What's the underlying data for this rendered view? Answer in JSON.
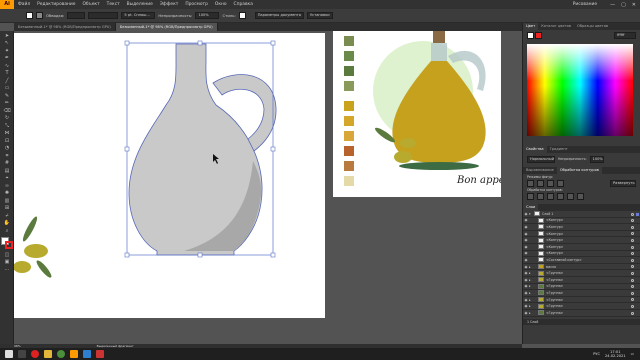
{
  "menubar": {
    "logo": "Ai",
    "items": [
      "Файл",
      "Редактирование",
      "Объект",
      "Текст",
      "Выделение",
      "Эффект",
      "Просмотр",
      "Окно",
      "Справка"
    ],
    "workspace": "Рисование"
  },
  "control": {
    "no_selection_swatch_1": "#ffffff",
    "stroke_label": "Обводка:",
    "brush": "5 pt. Сплош...",
    "opacity_label": "Непрозрачность:",
    "opacity_value": "100%",
    "style_label": "Стиль:",
    "doc_params_button": "Параметры документа",
    "settings_button": "Установки"
  },
  "tabs": [
    {
      "label": "Безымянный-1* @ 98% (RGB/Предпросмотр GPU)",
      "active": false
    },
    {
      "label": "Безымянный-1* @ 98% (RGB/Предпросмотр GPU)",
      "active": true
    }
  ],
  "canvas": {
    "reference_caption": "Bon appetit",
    "palette": [
      "#7a8c50",
      "#6a8a4a",
      "#5b7a3e",
      "#8a9a5a",
      "#c9a21e",
      "#d4a62a",
      "#d9a63a",
      "#b8622e",
      "#b87a3e",
      "#e5d9a8",
      "#eef5d9"
    ],
    "colors": {
      "jug_main": "#c9c9c9",
      "jug_shadow": "#a8a8a8",
      "olive": "#b7aa2e",
      "leaf": "#5b7a3e",
      "bottle_oil": "#c6a11e",
      "bottle_glass": "#b4c7c8",
      "cork": "#8a6a44",
      "bg_circle": "#dff2cf"
    }
  },
  "color_panel": {
    "tabs": [
      "Цвет",
      "Каталог цветов",
      "Образцы цветов"
    ],
    "hex": "ffffff"
  },
  "properties_panel": {
    "tabs": [
      "Свойства",
      "Градиент"
    ],
    "blend": "Нормальный",
    "opacity_label": "Непрозрачность:",
    "opacity": "100%"
  },
  "pathfinder_panel": {
    "tabs": [
      "Выравнивание",
      "Обработка контуров"
    ],
    "shape_modes_label": "Режимы фигур:",
    "pathfinders_label": "Обработка контуров:",
    "expand_button": "Развернуть"
  },
  "layers_panel": {
    "tabs": [
      "Слои"
    ],
    "rows": [
      {
        "label": "Слой 1",
        "depth": 0,
        "selected": true
      },
      {
        "label": "<Контур>",
        "depth": 1
      },
      {
        "label": "<Контур>",
        "depth": 1
      },
      {
        "label": "<Контур>",
        "depth": 1
      },
      {
        "label": "<Контур>",
        "depth": 1
      },
      {
        "label": "<Контур>",
        "depth": 1
      },
      {
        "label": "<Контур>",
        "depth": 1
      },
      {
        "label": "<Составной контур>",
        "depth": 1
      },
      {
        "label": "масло",
        "depth": 1
      },
      {
        "label": "<Группа>",
        "depth": 1
      },
      {
        "label": "<Группа>",
        "depth": 1
      },
      {
        "label": "<Группа>",
        "depth": 1
      },
      {
        "label": "<Группа>",
        "depth": 1
      },
      {
        "label": "<Группа>",
        "depth": 1
      },
      {
        "label": "<Группа>",
        "depth": 1
      },
      {
        "label": "<Группа>",
        "depth": 1
      }
    ],
    "footer": "1 Слой"
  },
  "status": {
    "zoom": "98%",
    "tool_label": "Выделенный фрагмент"
  },
  "taskbar": {
    "time": "17:01",
    "date": "24.02.2021",
    "lang": "РУС"
  }
}
